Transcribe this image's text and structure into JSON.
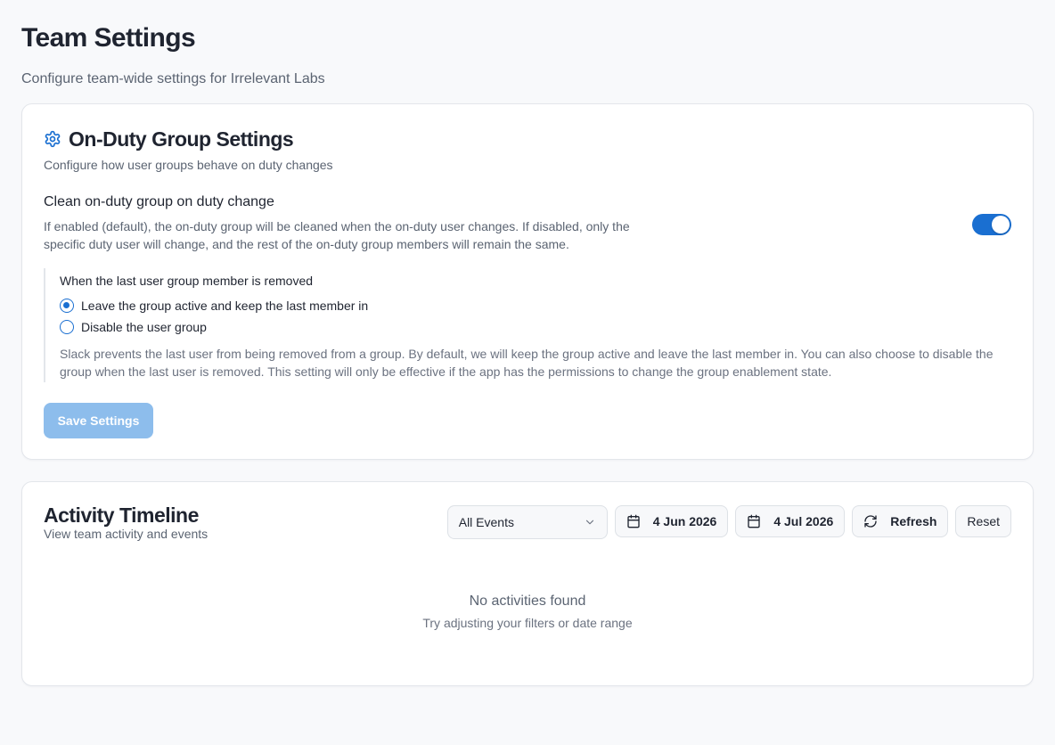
{
  "page": {
    "title": "Team Settings",
    "subtitle": "Configure team-wide settings for Irrelevant Labs"
  },
  "on_duty": {
    "icon": "gear-icon",
    "title": "On-Duty Group Settings",
    "description": "Configure how user groups behave on duty changes",
    "clean_group": {
      "title": "Clean on-duty group on duty change",
      "help": "If enabled (default), the on-duty group will be cleaned when the on-duty user changes. If disabled, only the specific duty user will change, and the rest of the on-duty group members will remain the same.",
      "enabled": true
    },
    "last_member": {
      "title": "When the last user group member is removed",
      "options": [
        {
          "label": "Leave the group active and keep the last member in",
          "selected": true
        },
        {
          "label": "Disable the user group",
          "selected": false
        }
      ],
      "help": "Slack prevents the last user from being removed from a group. By default, we will keep the group active and leave the last member in. You can also choose to disable the group when the last user is removed. This setting will only be effective if the app has the permissions to change the group enablement state."
    },
    "save_label": "Save Settings"
  },
  "activity": {
    "title": "Activity Timeline",
    "subtitle": "View team activity and events",
    "filter": {
      "selected": "All Events",
      "icon": "chevron-down-icon"
    },
    "start_date": {
      "label": "4 Jun 2026",
      "icon": "calendar-icon"
    },
    "end_date": {
      "label": "4 Jul 2026",
      "icon": "calendar-icon"
    },
    "refresh_label": "Refresh",
    "refresh_icon": "refresh-icon",
    "reset_label": "Reset",
    "empty_title": "No activities found",
    "empty_subtitle": "Try adjusting your filters or date range"
  },
  "colors": {
    "accent": "#1a6fd1",
    "accent_disabled": "#8dbdec",
    "background": "#f8f9fb"
  }
}
